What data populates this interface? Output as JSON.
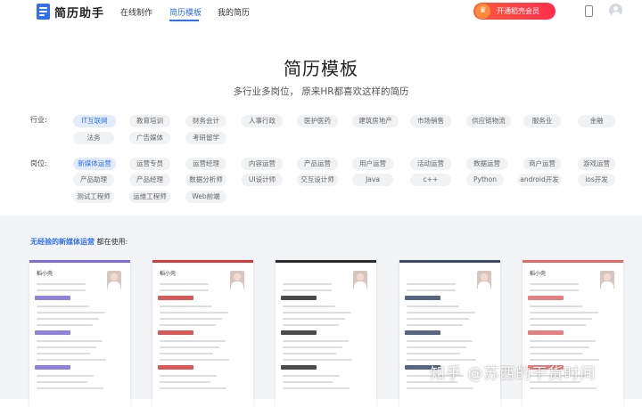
{
  "header": {
    "logo_text": "简历助手",
    "nav": [
      "在线制作",
      "简历模板",
      "我的简历"
    ],
    "active_nav": "简历模板",
    "vip_label": "开通稻壳会员"
  },
  "hero": {
    "title": "简历模板",
    "subtitle": "多行业多岗位， 原来HR都喜欢这样的简历"
  },
  "filters": {
    "industry_label": "行业:",
    "industry_tags": [
      "IT互联网",
      "教育培训",
      "财务会计",
      "人事行政",
      "医护医药",
      "建筑房地产",
      "市场销售",
      "供应链物流",
      "服务业",
      "金融",
      "法务",
      "广告媒体",
      "考研留学"
    ],
    "industry_active": "IT互联网",
    "position_label": "岗位:",
    "position_tags": [
      "新媒体运营",
      "运营专员",
      "运营经理",
      "内容运营",
      "产品运营",
      "用户运营",
      "活动运营",
      "数据运营",
      "商户运营",
      "游戏运营",
      "产品助理",
      "产品经理",
      "数据分析师",
      "UI设计师",
      "交互设计师",
      "Java",
      "c++",
      "Python",
      "android开发",
      "ios开发",
      "测试工程师",
      "运维工程师",
      "Web前端"
    ],
    "position_active": "新媒体运营"
  },
  "section": {
    "highlight": "无经验的新媒体运营",
    "suffix": " 都在使用:"
  },
  "cards": [
    {
      "name": "稻小壳",
      "accent": "#7d6bd6"
    },
    {
      "name": "稻小壳",
      "accent": "#d23b3b"
    },
    {
      "name": "",
      "accent": "#2b2b2b"
    },
    {
      "name": "",
      "accent": "#3a4a6b"
    },
    {
      "name": "稻小壳",
      "accent": "#e26a6a"
    }
  ],
  "watermark": "知乎 @苏西的干货时间",
  "colors": {
    "primary": "#2f6ff0",
    "vip_start": "#ff5a3c",
    "vip_end": "#ff2e4d",
    "lower_bg": "#f3f4f6"
  }
}
